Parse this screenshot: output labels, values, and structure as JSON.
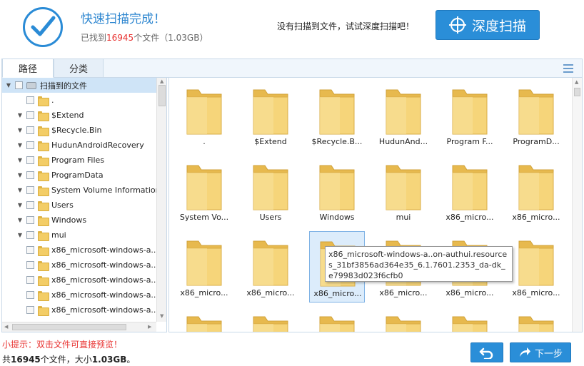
{
  "header": {
    "title": "快速扫描完成！",
    "found_prefix": "已找到",
    "found_count": "16945",
    "found_suffix": "个文件（1.03GB）",
    "deep_hint": "没有扫描到文件，试试深度扫描吧！",
    "deep_scan_label": "深度扫描"
  },
  "tabs": [
    {
      "label": "路径",
      "active": true
    },
    {
      "label": "分类",
      "active": false
    }
  ],
  "tree": {
    "root_label": "扫描到的文件",
    "items": [
      {
        "label": ".",
        "expandable": false
      },
      {
        "label": "$Extend",
        "expandable": true
      },
      {
        "label": "$Recycle.Bin",
        "expandable": true
      },
      {
        "label": "HudunAndroidRecovery",
        "expandable": true
      },
      {
        "label": "Program Files",
        "expandable": true
      },
      {
        "label": "ProgramData",
        "expandable": true
      },
      {
        "label": "System Volume Information",
        "expandable": true
      },
      {
        "label": "Users",
        "expandable": true
      },
      {
        "label": "Windows",
        "expandable": true
      },
      {
        "label": "mui",
        "expandable": true
      },
      {
        "label": "x86_microsoft-windows-a..ac",
        "expandable": false
      },
      {
        "label": "x86_microsoft-windows-a..on",
        "expandable": false
      },
      {
        "label": "x86_microsoft-windows-a..on",
        "expandable": false
      },
      {
        "label": "x86_microsoft-windows-a..on",
        "expandable": false
      },
      {
        "label": "x86_microsoft-windows-a..on",
        "expandable": false
      }
    ]
  },
  "grid": {
    "items": [
      {
        "label": "."
      },
      {
        "label": "$Extend"
      },
      {
        "label": "$Recycle.B..."
      },
      {
        "label": "HudunAnd..."
      },
      {
        "label": "Program F..."
      },
      {
        "label": "ProgramD..."
      },
      {
        "label": "System Vo..."
      },
      {
        "label": "Users"
      },
      {
        "label": "Windows"
      },
      {
        "label": "mui"
      },
      {
        "label": "x86_micro..."
      },
      {
        "label": "x86_micro..."
      },
      {
        "label": "x86_micro..."
      },
      {
        "label": "x86_micro..."
      },
      {
        "label": "x86_micro..."
      },
      {
        "label": "x86_micro..."
      },
      {
        "label": "x86_micro..."
      },
      {
        "label": "x86_micro..."
      }
    ],
    "tooltip": "x86_microsoft-windows-a..on-authui.resources_31bf3856ad364e35_6.1.7601.2353_da-dk_e79983d023f6cfb0"
  },
  "footer": {
    "tip": "小提示：双击文件可直接预览！",
    "summary_prefix": "共",
    "summary_count": "16945",
    "summary_mid": "个文件，大小",
    "summary_size": "1.03GB",
    "summary_suffix": "。",
    "next_label": "下一步"
  },
  "colors": {
    "accent": "#2a8ed8",
    "highlight_red": "#e8312f",
    "folder_yellow": "#f3cd66"
  }
}
